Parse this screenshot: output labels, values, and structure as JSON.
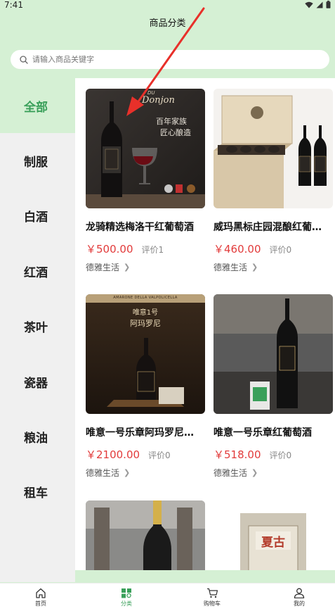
{
  "status_bar": {
    "time": "7:41"
  },
  "header": {
    "title": "商品分类"
  },
  "search": {
    "placeholder": "请输入商品关键字"
  },
  "sidebar": {
    "items": [
      {
        "label": "全部",
        "active": true
      },
      {
        "label": "制服"
      },
      {
        "label": "白酒"
      },
      {
        "label": "红酒"
      },
      {
        "label": "茶叶"
      },
      {
        "label": "瓷器"
      },
      {
        "label": "粮油"
      },
      {
        "label": "租车"
      }
    ]
  },
  "products": [
    {
      "name": "龙骑精选梅洛干红葡萄酒",
      "price": "￥500.00",
      "reviews": "评价1",
      "shop": "德雅生活",
      "img_text": {
        "brand_small": "DU",
        "brand": "Donjon",
        "line1": "百年家族",
        "line2": "匠心酿造"
      }
    },
    {
      "name": "威玛黑标庄园混酿红葡萄酒",
      "price": "￥460.00",
      "reviews": "评价0",
      "shop": "德雅生活"
    },
    {
      "name": "唯意一号乐章阿玛罗尼红葡萄酒",
      "price": "￥2100.00",
      "reviews": "评价0",
      "shop": "德雅生活",
      "img_text": {
        "top": "AMARONE DELLA VALPOLICELLA",
        "line1": "唯意1号",
        "line2": "阿玛罗尼"
      }
    },
    {
      "name": "唯意一号乐章红葡萄酒",
      "price": "￥518.00",
      "reviews": "评价0",
      "shop": "德雅生活"
    },
    {
      "name": "",
      "price": "",
      "reviews": "",
      "shop": ""
    },
    {
      "name": "",
      "price": "",
      "reviews": "",
      "shop": "",
      "img_text": {
        "line1": "夏古"
      }
    }
  ],
  "bottom_nav": {
    "items": [
      {
        "label": "首页",
        "icon": "home-icon"
      },
      {
        "label": "分类",
        "icon": "category-icon",
        "active": true
      },
      {
        "label": "购物车",
        "icon": "cart-icon"
      },
      {
        "label": "我的",
        "icon": "user-icon"
      }
    ]
  },
  "colors": {
    "accent": "#3aa05a",
    "header_bg": "#d5f0d4",
    "price": "#e23b3b",
    "annotation": "#e8302a"
  }
}
